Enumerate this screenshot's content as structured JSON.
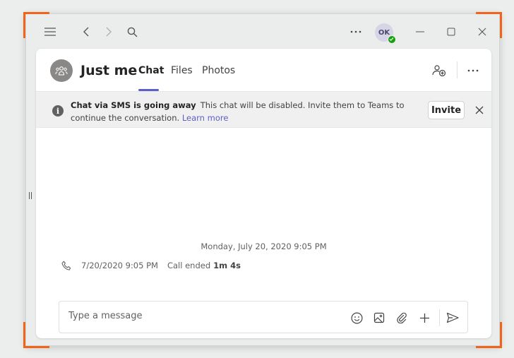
{
  "titlebar": {
    "icons": [
      "menu-icon",
      "back-icon",
      "forward-icon",
      "search-icon",
      "more-icon",
      "minimize-icon",
      "maximize-icon",
      "close-icon"
    ],
    "avatar_initials": "OK"
  },
  "chat": {
    "title": "Just me",
    "tabs": [
      {
        "label": "Chat",
        "active": true
      },
      {
        "label": "Files",
        "active": false
      },
      {
        "label": "Photos",
        "active": false
      }
    ]
  },
  "banner": {
    "heading": "Chat via SMS is going away",
    "message": "This chat will be disabled. Invite them to Teams to continue the conversation.",
    "link": "Learn more",
    "invite_label": "Invite"
  },
  "messages": {
    "date_separator": "Monday, July 20, 2020 9:05 PM",
    "call": {
      "timestamp": "7/20/2020 9:05 PM",
      "text": "Call ended",
      "duration": "1m 4s"
    }
  },
  "composer": {
    "placeholder": "Type a message"
  },
  "colors": {
    "accent": "#5b5fc7",
    "presence": "#13a10e",
    "highlight": "#f0641c"
  }
}
